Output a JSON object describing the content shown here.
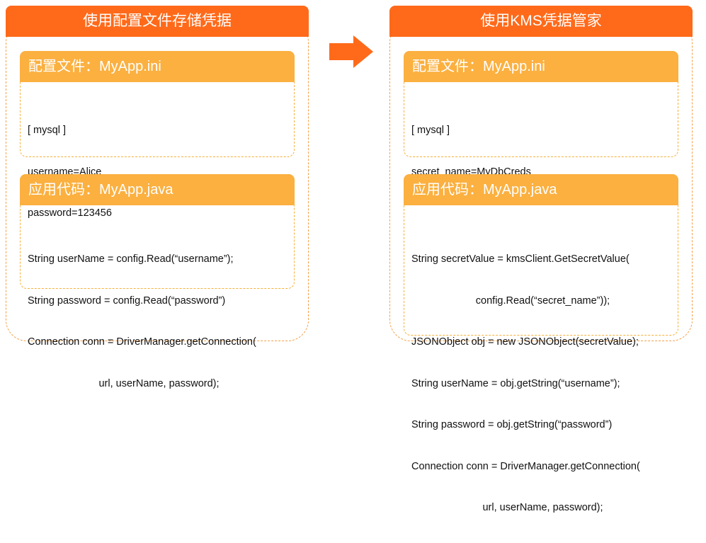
{
  "left_panel": {
    "title": "使用配置文件存储凭据",
    "config_box": {
      "title": "配置文件：MyApp.ini",
      "lines": [
        "[ mysql ]",
        "username=Alice",
        "password=123456"
      ]
    },
    "code_box": {
      "title": "应用代码：MyApp.java",
      "lines": [
        "String userName = config.Read(“username”);",
        "String password = config.Read(“password”)",
        "Connection conn = DriverManager.getConnection(",
        "url, userName, password);"
      ]
    }
  },
  "right_panel": {
    "title": "使用KMS凭据管家",
    "config_box": {
      "title": "配置文件：MyApp.ini",
      "lines": [
        "[ mysql ]",
        "secret_name=MyDbCreds"
      ]
    },
    "code_box": {
      "title": "应用代码：MyApp.java",
      "lines": [
        "String secretValue = kmsClient.GetSecretValue(",
        "config.Read(“secret_name”));",
        "JSONObject obj = new JSONObject(secretValue);",
        "String userName = obj.getString(“username”);",
        "String password = obj.getString(“password”)",
        "Connection conn = DriverManager.getConnection(",
        "url, userName, password);"
      ]
    }
  },
  "colors": {
    "panel_header": "#ff6a1a",
    "box_header": "#fbb040",
    "arrow": "#ff6a1a",
    "dashed_border": "#f5a04a"
  }
}
